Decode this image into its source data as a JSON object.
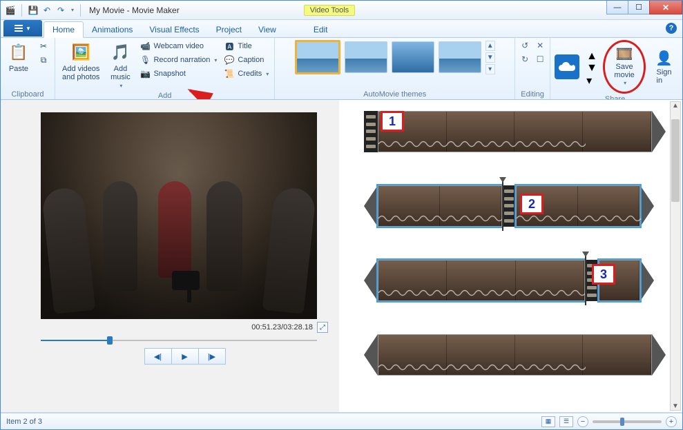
{
  "window": {
    "title": "My Movie - Movie Maker",
    "contextual_tab": "Video Tools"
  },
  "tabs": {
    "file": "",
    "items": [
      "Home",
      "Animations",
      "Visual Effects",
      "Project",
      "View",
      "Edit"
    ],
    "active": "Home"
  },
  "ribbon": {
    "clipboard": {
      "label": "Clipboard",
      "paste": "Paste"
    },
    "add": {
      "label": "Add",
      "add_videos": "Add videos\nand photos",
      "add_music": "Add\nmusic",
      "webcam": "Webcam video",
      "narration": "Record narration",
      "snapshot": "Snapshot",
      "title": "Title",
      "caption": "Caption",
      "credits": "Credits"
    },
    "themes": {
      "label": "AutoMovie themes"
    },
    "editing": {
      "label": "Editing"
    },
    "share": {
      "label": "Share",
      "save_movie": "Save\nmovie",
      "sign_in": "Sign\nin"
    }
  },
  "preview": {
    "time": "00:51.23/03:28.18"
  },
  "timeline": {
    "markers": [
      "1",
      "2",
      "3"
    ]
  },
  "status": {
    "item": "Item 2 of 3"
  }
}
